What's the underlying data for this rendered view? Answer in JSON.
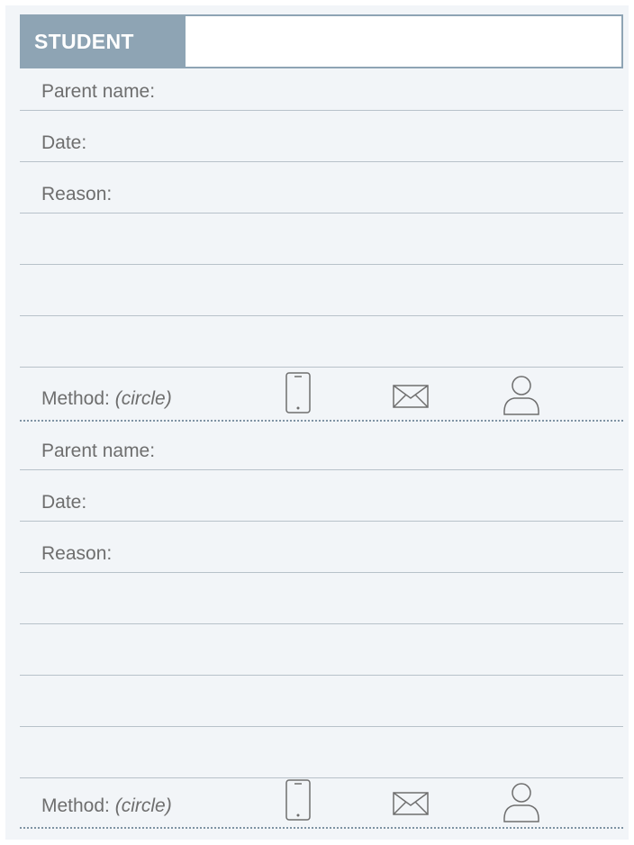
{
  "header": {
    "label": "STUDENT",
    "value": ""
  },
  "sections": [
    {
      "parent_name_label": "Parent name:",
      "date_label": "Date:",
      "reason_label": "Reason:",
      "method_label": "Method:",
      "method_hint": "(circle)",
      "method_icons": [
        "phone-icon",
        "envelope-icon",
        "person-icon"
      ]
    },
    {
      "parent_name_label": "Parent name:",
      "date_label": "Date:",
      "reason_label": "Reason:",
      "method_label": "Method:",
      "method_hint": "(circle)",
      "method_icons": [
        "phone-icon",
        "envelope-icon",
        "person-icon"
      ]
    }
  ],
  "colors": {
    "accent": "#8ea4b4",
    "background": "#f2f5f8",
    "text": "#6e6e6e"
  }
}
